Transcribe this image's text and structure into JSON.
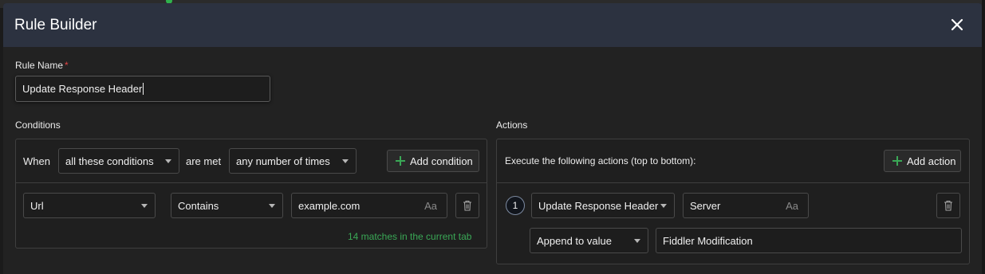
{
  "dialog": {
    "title": "Rule Builder",
    "close_icon": "close-icon"
  },
  "rule_name": {
    "label": "Rule Name",
    "required_mark": "*",
    "value": "Update Response Header"
  },
  "conditions": {
    "section_label": "Conditions",
    "when_label": "When",
    "match_mode": "all these conditions",
    "are_met_label": "are met",
    "frequency": "any number of times",
    "add_button_label": "Add condition",
    "rows": [
      {
        "field": "Url",
        "operator": "Contains",
        "value": "example.com",
        "case_toggle": "Aa"
      }
    ],
    "match_status": "14 matches in the current tab"
  },
  "actions": {
    "section_label": "Actions",
    "header_text": "Execute the following actions (top to bottom):",
    "add_button_label": "Add action",
    "rows": [
      {
        "step": "1",
        "action_type": "Update Response Header",
        "header_name": "Server",
        "case_toggle": "Aa",
        "mode": "Append to value",
        "value": "Fiddler Modification"
      }
    ]
  },
  "colors": {
    "title_bar": "#2c3240",
    "dialog_bg": "#222222",
    "accent_green": "#3aa856",
    "required_red": "#e04545"
  }
}
